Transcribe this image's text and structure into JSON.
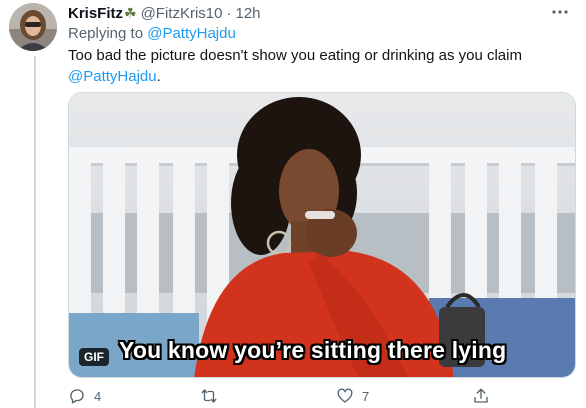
{
  "author": {
    "display_name": "KrisFitz",
    "name_emoji": "☘",
    "handle": "@FitzKris10",
    "separator": "·",
    "timestamp": "12h"
  },
  "reply": {
    "prefix": "Replying to",
    "mention": "@PattyHajdu"
  },
  "tweet": {
    "text_line1": "Too bad the picture doesn't show you eating or drinking as you claim",
    "mention": "@PattyHajdu",
    "text_end": "."
  },
  "media": {
    "badge": "GIF",
    "caption": "You know you’re sitting there lying"
  },
  "actions": {
    "reply_count": "4",
    "retweet_count": "",
    "like_count": "7"
  },
  "colors": {
    "accent": "#1d9bf0",
    "muted": "#536471",
    "text": "#0f1419",
    "border": "#cfd9de"
  },
  "icons": [
    "more-icon",
    "reply-icon",
    "retweet-icon",
    "like-icon",
    "share-icon"
  ]
}
